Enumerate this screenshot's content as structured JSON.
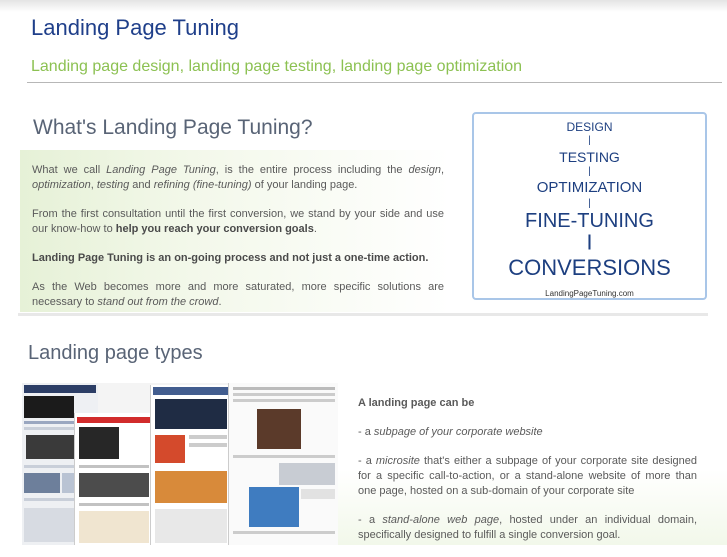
{
  "header": {
    "title": "Landing Page Tuning",
    "tagline": "Landing page design, landing page testing, landing page optimization"
  },
  "intro": {
    "heading": "What's Landing Page Tuning?",
    "p1": {
      "a": "What we call ",
      "b": "Landing Page Tuning",
      "c": ", is the entire process including the ",
      "d": "design",
      "e": ", ",
      "f": "optimization",
      "g": ", ",
      "h": "testing",
      "i": " and ",
      "j": "refining (fine-tuning)",
      "k": " of your landing page."
    },
    "p2": {
      "a": "From the first consultation until the first conversion, we stand by your side and use our know-how to ",
      "b": "help you reach your conversion goals",
      "c": "."
    },
    "p3": "Landing Page Tuning is an on-going process and not just a one-time action.",
    "p4": {
      "a": "As the Web becomes more and more saturated, more specific solutions are necessary to ",
      "b": "stand out from the crowd",
      "c": "."
    }
  },
  "diagram": {
    "steps": [
      "DESIGN",
      "TESTING",
      "OPTIMIZATION",
      "FINE-TUNING",
      "CONVERSIONS"
    ],
    "separator": "|",
    "url": "LandingPageTuning.com",
    "text_color": "#1d3f80",
    "border_color": "#a9c6e8"
  },
  "types": {
    "heading": "Landing page types",
    "intro": "A landing page can be",
    "item1": {
      "a": "- a ",
      "b": "subpage of your corporate website"
    },
    "item2": {
      "a": "- a ",
      "b": "microsite",
      "c": " that's either a subpage of your corporate site designed for a specific call-to-action, or a stand-alone website of more than one page, hosted on a sub-domain of your corporate site"
    },
    "item3": {
      "a": "- a ",
      "b": "stand-alone web page",
      "c": ", hosted under an individual domain, specifically designed to fulfill a single conversion goal."
    }
  },
  "colors": {
    "title": "#1f3f8a",
    "tagline": "#8cc152",
    "heading": "#596476",
    "intro_background": "#e6f1d7"
  }
}
